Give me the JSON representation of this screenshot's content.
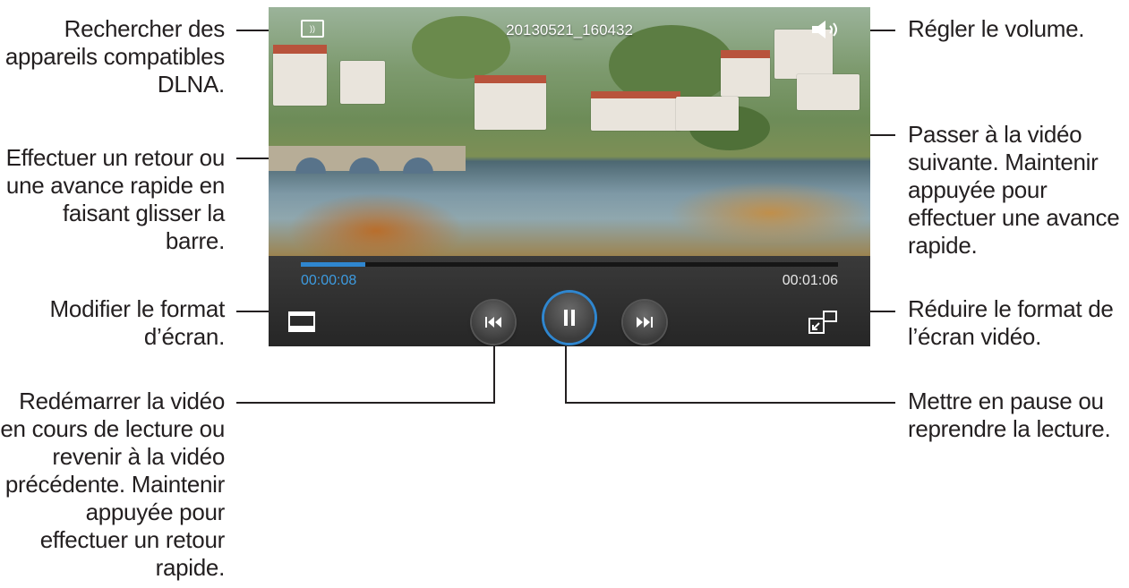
{
  "player": {
    "title": "20130521_160432",
    "elapsed": "00:00:08",
    "duration": "00:01:06",
    "progress_fraction": 0.12,
    "cast_icon_text": "))"
  },
  "callouts": {
    "search_dlna": "Rechercher des\nappareils compatibles\nDLNA.",
    "seek_bar": "Effectuer un retour ou\nune avance rapide en\nfaisant glisser la barre.",
    "screen_format": "Modifier le format\nd’écran.",
    "previous": "Redémarrer la vidéo\nen cours de lecture ou\nrevenir à la vidéo\nprécédente. Maintenir\nappuyée pour\neffectuer un retour\nrapide.",
    "volume": "Régler le volume.",
    "next": "Passer à la vidéo\nsuivante. Maintenir\nappuyée pour\neffectuer une avance\nrapide.",
    "popup": "Réduire le format de\nl’écran vidéo.",
    "pause": "Mettre en pause ou\nreprendre la lecture."
  },
  "colors": {
    "accent": "#2f86cf",
    "controls_bg": "#2e2e2e",
    "text": "#231f20"
  },
  "icons": [
    "cast-icon",
    "volume-icon",
    "screen-format-icon",
    "previous-icon",
    "pause-icon",
    "next-icon",
    "popup-player-icon"
  ]
}
